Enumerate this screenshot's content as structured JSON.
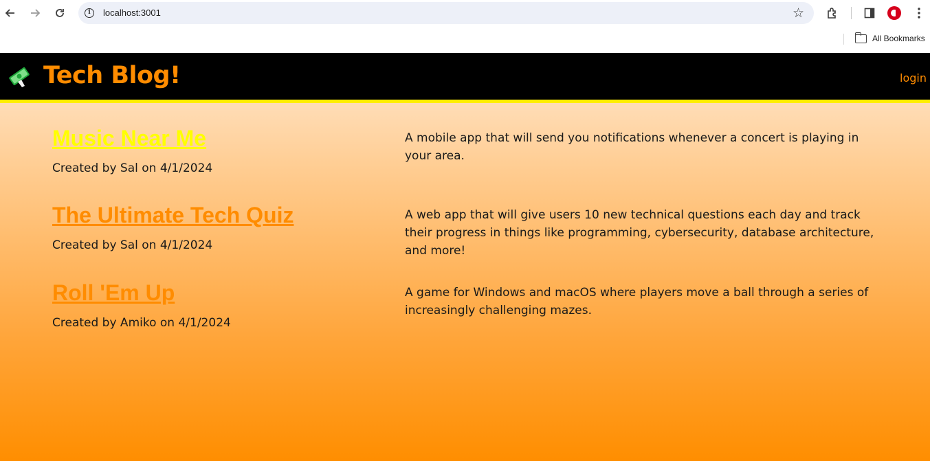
{
  "browser": {
    "url": "localhost:3001",
    "bookmarks_label": "All Bookmarks"
  },
  "site": {
    "title": "Tech Blog!",
    "login_label": "login",
    "colors": {
      "header_bg": "#000000",
      "accent": "#ff8c00",
      "highlight": "#ffee00"
    }
  },
  "posts": [
    {
      "title": "Music Near Me",
      "meta": "Created by Sal on 4/1/2024",
      "description": "A mobile app that will send you notifications whenever a concert is playing in your area."
    },
    {
      "title": "The Ultimate Tech Quiz",
      "meta": "Created by Sal on 4/1/2024",
      "description": "A web app that will give users 10 new technical questions each day and track their progress in things like programming, cybersecurity, database architecture, and more!"
    },
    {
      "title": "Roll 'Em Up",
      "meta": "Created by Amiko on 4/1/2024",
      "description": "A game for Windows and macOS where players move a ball through a series of increasingly challenging mazes."
    }
  ]
}
